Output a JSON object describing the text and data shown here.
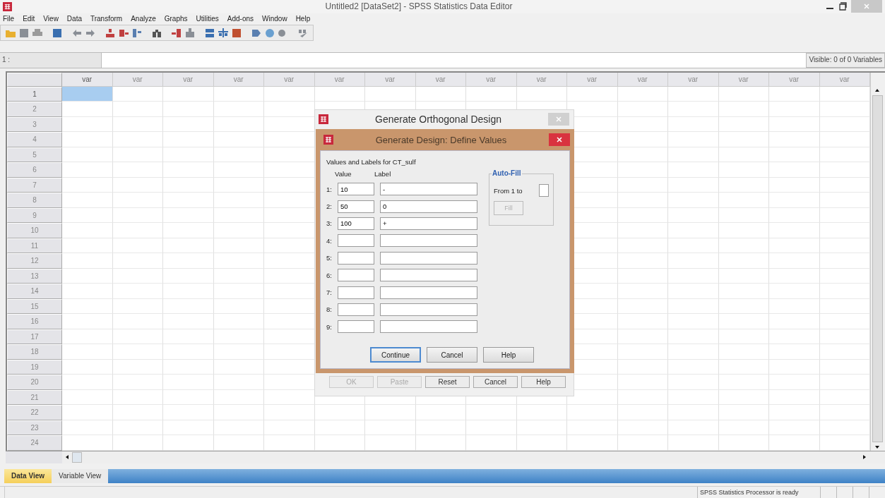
{
  "window": {
    "title": "Untitled2 [DataSet2] - SPSS Statistics Data Editor"
  },
  "menu": [
    "File",
    "Edit",
    "View",
    "Data",
    "Transform",
    "Analyze",
    "Graphs",
    "Utilities",
    "Add-ons",
    "Window",
    "Help"
  ],
  "cell_editor": {
    "label": "1 :",
    "visible_count": "Visible: 0 of 0 Variables"
  },
  "grid": {
    "columns": [
      {
        "label": "var",
        "selected": true
      },
      {
        "label": "var",
        "selected": false
      },
      {
        "label": "var",
        "selected": false
      },
      {
        "label": "var",
        "selected": false
      },
      {
        "label": "var",
        "selected": false
      },
      {
        "label": "var",
        "selected": false
      },
      {
        "label": "var",
        "selected": false
      },
      {
        "label": "var",
        "selected": false
      },
      {
        "label": "var",
        "selected": false
      },
      {
        "label": "var",
        "selected": false
      },
      {
        "label": "var",
        "selected": false
      },
      {
        "label": "var",
        "selected": false
      },
      {
        "label": "var",
        "selected": false
      },
      {
        "label": "var",
        "selected": false
      },
      {
        "label": "var",
        "selected": false
      },
      {
        "label": "var",
        "selected": false
      }
    ],
    "rows": [
      {
        "label": "1",
        "selected": true
      },
      {
        "label": "2",
        "selected": false
      },
      {
        "label": "3",
        "selected": false
      },
      {
        "label": "4",
        "selected": false
      },
      {
        "label": "5",
        "selected": false
      },
      {
        "label": "6",
        "selected": false
      },
      {
        "label": "7",
        "selected": false
      },
      {
        "label": "8",
        "selected": false
      },
      {
        "label": "9",
        "selected": false
      },
      {
        "label": "10",
        "selected": false
      },
      {
        "label": "11",
        "selected": false
      },
      {
        "label": "12",
        "selected": false
      },
      {
        "label": "13",
        "selected": false
      },
      {
        "label": "14",
        "selected": false
      },
      {
        "label": "15",
        "selected": false
      },
      {
        "label": "16",
        "selected": false
      },
      {
        "label": "17",
        "selected": false
      },
      {
        "label": "18",
        "selected": false
      },
      {
        "label": "19",
        "selected": false
      },
      {
        "label": "20",
        "selected": false
      },
      {
        "label": "21",
        "selected": false
      },
      {
        "label": "22",
        "selected": false
      },
      {
        "label": "23",
        "selected": false
      },
      {
        "label": "24",
        "selected": false
      }
    ]
  },
  "tabs": [
    {
      "label": "Data View",
      "selected": true
    },
    {
      "label": "Variable View",
      "selected": false
    }
  ],
  "status_bar": {
    "message": "SPSS Statistics  Processor is ready"
  },
  "back_dialog": {
    "title": "Generate Orthogonal Design",
    "buttons": [
      {
        "label": "OK",
        "disabled": true
      },
      {
        "label": "Paste",
        "disabled": true
      },
      {
        "label": "Reset",
        "disabled": false
      },
      {
        "label": "Cancel",
        "disabled": false
      },
      {
        "label": "Help",
        "disabled": false
      }
    ]
  },
  "dialog": {
    "title": "Generate Design: Define Values",
    "caption": "Values and Labels for CT_sulf",
    "value_header": "Value",
    "label_header": "Label",
    "rows": [
      {
        "number": "1:",
        "value": "10",
        "label": "-"
      },
      {
        "number": "2:",
        "value": "50",
        "label": "0"
      },
      {
        "number": "3:",
        "value": "100",
        "label": "+"
      },
      {
        "number": "4:"
      },
      {
        "number": "5:"
      },
      {
        "number": "6:"
      },
      {
        "number": "7:"
      },
      {
        "number": "8:"
      },
      {
        "number": "9:"
      }
    ],
    "auto_fill": {
      "title": "Auto-Fill",
      "from_label": "From 1 to",
      "fill_button": {
        "label": "Fill",
        "disabled": true
      }
    },
    "buttons": [
      {
        "label": "Continue",
        "default": true
      },
      {
        "label": "Cancel",
        "default": false
      },
      {
        "label": "Help",
        "default": false
      }
    ]
  }
}
